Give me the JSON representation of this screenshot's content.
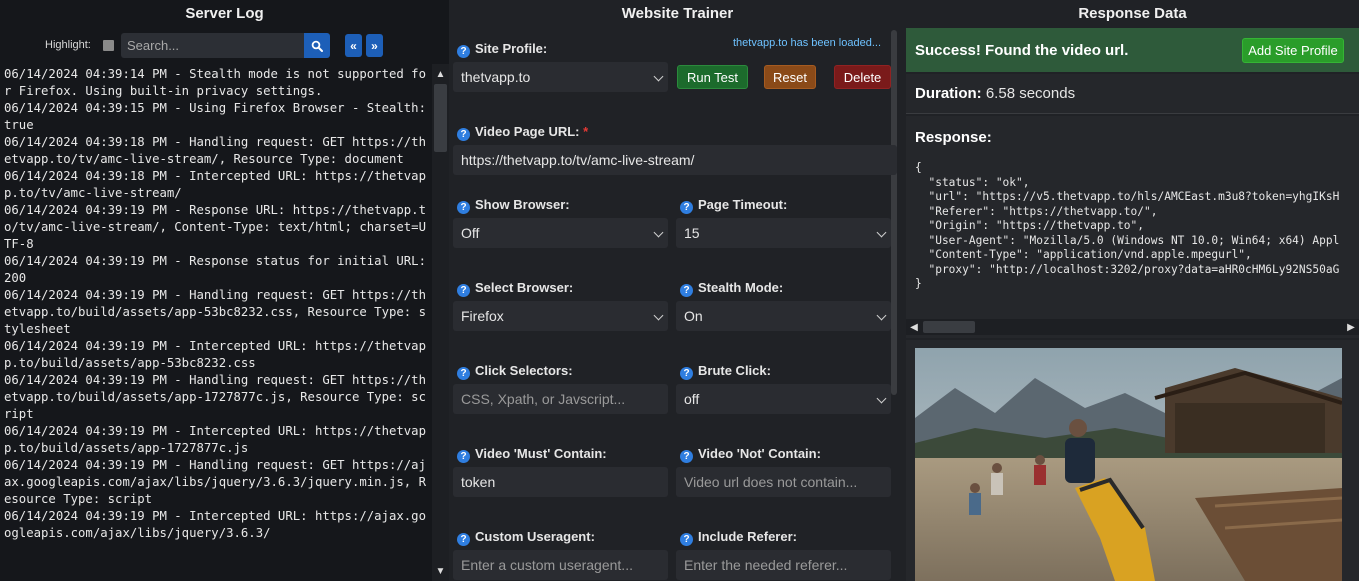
{
  "server_log": {
    "title": "Server Log",
    "highlight_label": "Highlight:",
    "search_placeholder": "Search...",
    "prev_label": "«",
    "next_label": "»",
    "lines": [
      "06/14/2024 04:39:14 PM - Stealth mode is not supported for Firefox. Using built-in privacy settings.",
      "06/14/2024 04:39:15 PM - Using Firefox Browser - Stealth: true",
      "06/14/2024 04:39:18 PM - Handling request: GET https://thetvapp.to/tv/amc-live-stream/, Resource Type: document",
      "06/14/2024 04:39:18 PM - Intercepted URL: https://thetvapp.to/tv/amc-live-stream/",
      "06/14/2024 04:39:19 PM - Response URL: https://thetvapp.to/tv/amc-live-stream/, Content-Type: text/html; charset=UTF-8",
      "06/14/2024 04:39:19 PM - Response status for initial URL: 200",
      "06/14/2024 04:39:19 PM - Handling request: GET https://thetvapp.to/build/assets/app-53bc8232.css, Resource Type: stylesheet",
      "06/14/2024 04:39:19 PM - Intercepted URL: https://thetvapp.to/build/assets/app-53bc8232.css",
      "06/14/2024 04:39:19 PM - Handling request: GET https://thetvapp.to/build/assets/app-1727877c.js, Resource Type: script",
      "06/14/2024 04:39:19 PM - Intercepted URL: https://thetvapp.to/build/assets/app-1727877c.js",
      "06/14/2024 04:39:19 PM - Handling request: GET https://ajax.googleapis.com/ajax/libs/jquery/3.6.3/jquery.min.js, Resource Type: script",
      "06/14/2024 04:39:19 PM - Intercepted URL: https://ajax.googleapis.com/ajax/libs/jquery/3.6.3/"
    ]
  },
  "trainer": {
    "title": "Website Trainer",
    "loaded_msg": "thetvapp.to has been loaded...",
    "site_profile": {
      "label": "Site Profile:",
      "value": "thetvapp.to"
    },
    "buttons": {
      "run": "Run Test",
      "reset": "Reset",
      "delete": "Delete"
    },
    "video_url": {
      "label": "Video Page URL:",
      "required_mark": "*",
      "value": "https://thetvapp.to/tv/amc-live-stream/"
    },
    "show_browser": {
      "label": "Show Browser:",
      "value": "Off"
    },
    "page_timeout": {
      "label": "Page Timeout:",
      "value": "15"
    },
    "select_browser": {
      "label": "Select Browser:",
      "value": "Firefox"
    },
    "stealth_mode": {
      "label": "Stealth Mode:",
      "value": "On"
    },
    "click_selectors": {
      "label": "Click Selectors:",
      "placeholder": "CSS, Xpath, or Javscript..."
    },
    "brute_click": {
      "label": "Brute Click:",
      "value": "off"
    },
    "must_contain": {
      "label": "Video 'Must' Contain:",
      "value": "token"
    },
    "not_contain": {
      "label": "Video 'Not' Contain:",
      "placeholder": "Video url does not contain..."
    },
    "custom_useragent": {
      "label": "Custom Useragent:",
      "placeholder": "Enter a custom useragent..."
    },
    "include_referer": {
      "label": "Include Referer:",
      "placeholder": "Enter the needed referer..."
    },
    "help_glyph": "?"
  },
  "response": {
    "title": "Response Data",
    "success_text": "Success! Found the video url.",
    "add_profile_label": "Add Site Profile",
    "duration_label": "Duration:",
    "duration_value": "6.58 seconds",
    "response_label": "Response:",
    "json_lines": [
      "{",
      "  \"status\": \"ok\",",
      "  \"url\": \"https://v5.thetvapp.to/hls/AMCEast.m3u8?token=yhgIKsH",
      "  \"Referer\": \"https://thetvapp.to/\",",
      "  \"Origin\": \"https://thetvapp.to\",",
      "  \"User-Agent\": \"Mozilla/5.0 (Windows NT 10.0; Win64; x64) Appl",
      "  \"Content-Type\": \"application/vnd.apple.mpegurl\",",
      "  \"proxy\": \"http://localhost:3202/proxy?data=aHR0cHM6Ly92NS50aG",
      "}"
    ]
  },
  "colors": {
    "accent_blue": "#1d5fb8",
    "success_green": "#2e5a3a",
    "run_green": "#1c6b2c",
    "reset_orange": "#8a4a18",
    "delete_red": "#7a1a1a",
    "link_blue": "#6ec2ff"
  }
}
